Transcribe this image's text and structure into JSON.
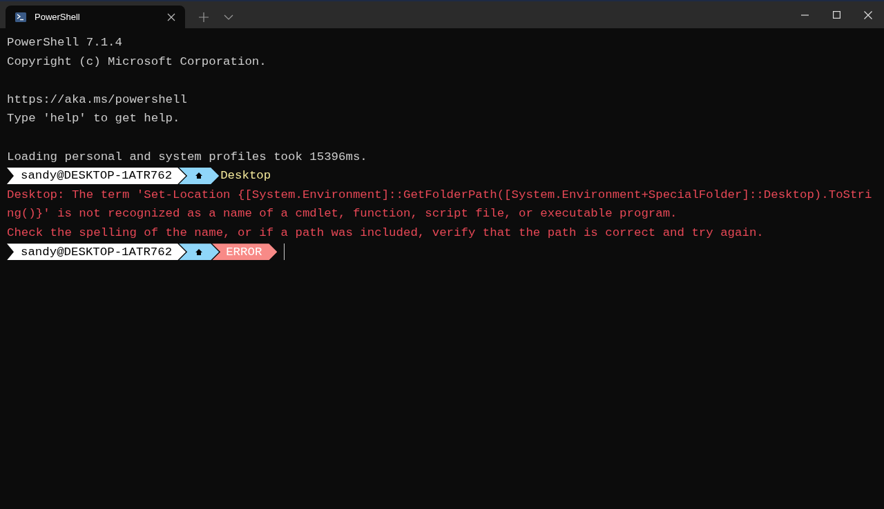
{
  "tab": {
    "title": "PowerShell",
    "selected": true
  },
  "lines": [
    {
      "kind": "output",
      "text": "PowerShell 7.1.4"
    },
    {
      "kind": "output",
      "text": "Copyright (c) Microsoft Corporation."
    },
    {
      "kind": "blank"
    },
    {
      "kind": "output",
      "text": "https://aka.ms/powershell"
    },
    {
      "kind": "output",
      "text": "Type 'help' to get help."
    },
    {
      "kind": "blank"
    },
    {
      "kind": "output",
      "text": "Loading personal and system profiles took 15396ms."
    },
    {
      "kind": "prompt",
      "segments": [
        {
          "kind": "user",
          "text": "sandy@DESKTOP-1ATR762"
        },
        {
          "kind": "home"
        },
        {
          "kind": "path",
          "text": "Desktop"
        }
      ],
      "cursor": false
    },
    {
      "kind": "error",
      "text": "Desktop: The term 'Set-Location {[System.Environment]::GetFolderPath([System.Environment+SpecialFolder]::Desktop).ToStri"
    },
    {
      "kind": "error",
      "text": "ng()}' is not recognized as a name of a cmdlet, function, script file, or executable program."
    },
    {
      "kind": "error",
      "text": "Check the spelling of the name, or if a path was included, verify that the path is correct and try again."
    },
    {
      "kind": "prompt",
      "segments": [
        {
          "kind": "user",
          "text": "sandy@DESKTOP-1ATR762"
        },
        {
          "kind": "home"
        },
        {
          "kind": "error",
          "text": "ERROR"
        }
      ],
      "cursor": true
    }
  ]
}
